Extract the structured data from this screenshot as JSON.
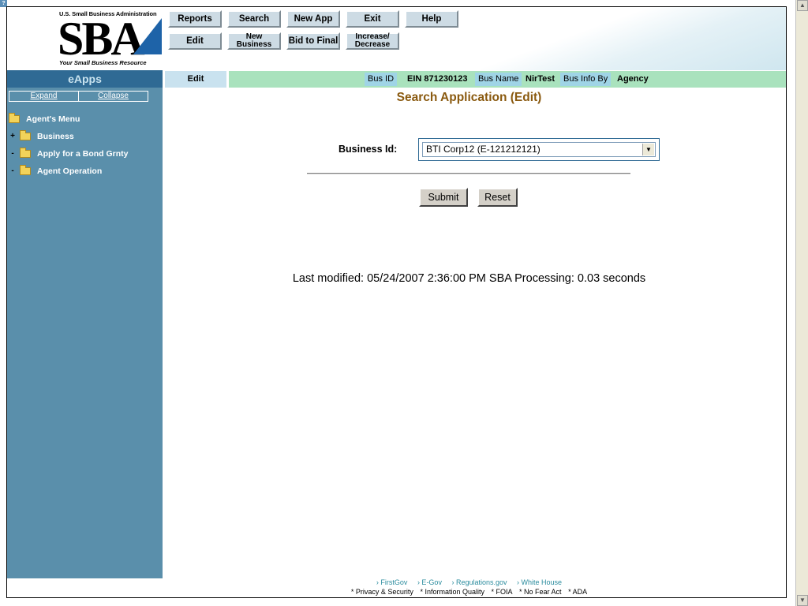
{
  "header": {
    "logo_top": "U.S. Small Business Administration",
    "logo_main": "SBA",
    "logo_tagline": "Your Small Business Resource",
    "nav_row1": [
      "Reports",
      "Search",
      "New App",
      "Exit",
      "Help"
    ],
    "nav_row2": [
      "Edit",
      "New Business",
      "Bid to Final",
      "Increase/ Decrease"
    ]
  },
  "sidebar": {
    "title": "eApps",
    "expand": "Expand",
    "collapse": "Collapse",
    "items": [
      {
        "toggle": "",
        "label": "Agent's Menu"
      },
      {
        "toggle": "+",
        "label": "Business"
      },
      {
        "toggle": "-",
        "label": "Apply for a Bond Grnty"
      },
      {
        "toggle": "-",
        "label": "Agent Operation"
      }
    ]
  },
  "infobar": {
    "tab": "Edit",
    "bus_id_label": "Bus ID",
    "ein": "EIN  871230123",
    "bus_name_label": "Bus Name",
    "bus_name": "NirTest",
    "bus_info_by_label": "Bus Info By",
    "bus_info_by": "Agency"
  },
  "main": {
    "title": "Search Application (Edit)",
    "business_id_label": "Business Id:",
    "business_id_value": "BTI Corp12 (E-121212121)",
    "submit": "Submit",
    "reset": "Reset",
    "last_modified": "Last modified: 05/24/2007 2:36:00 PM   SBA Processing:  0.03 seconds"
  },
  "footer": {
    "links": [
      "› FirstGov",
      "› E-Gov",
      "› Regulations.gov",
      "› White House"
    ],
    "policy": [
      "* Privacy & Security",
      "* Information Quality",
      "* FOIA",
      "* No Fear Act",
      "* ADA"
    ]
  },
  "colors": {
    "sidebar": "#5a8fab",
    "eapps_bar": "#2f6a94",
    "info_bar": "#a9e2bd",
    "title": "#8a5a10"
  }
}
